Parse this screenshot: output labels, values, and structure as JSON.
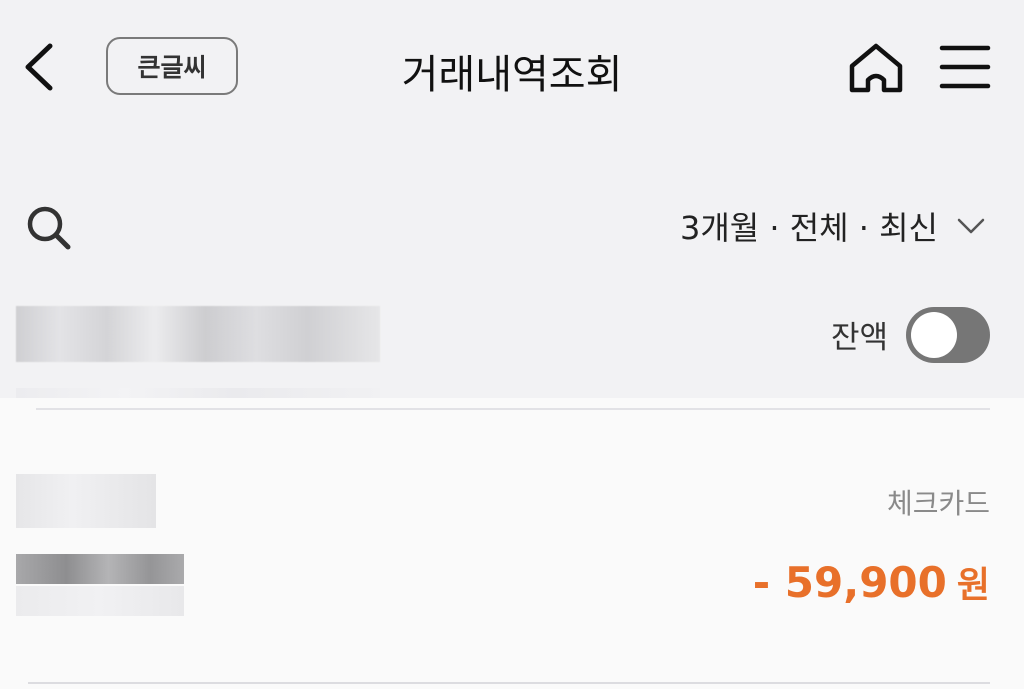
{
  "header": {
    "title": "거래내역조회",
    "big_font_label": "큰글씨",
    "back_icon": "chevron-left-icon",
    "home_icon": "home-icon",
    "menu_icon": "hamburger-menu-icon"
  },
  "filter": {
    "search_icon": "search-icon",
    "label": "3개월 · 전체 · 최신",
    "dropdown_icon": "chevron-down-icon"
  },
  "balance": {
    "label": "잔액",
    "toggle_on": false
  },
  "transactions": [
    {
      "type": "체크카드",
      "amount": "- 59,900",
      "currency": "원"
    }
  ],
  "colors": {
    "background": "#f2f2f4",
    "list_background": "#fafafa",
    "amount_withdrawal": "#e8702a",
    "toggle_off": "#767676"
  }
}
